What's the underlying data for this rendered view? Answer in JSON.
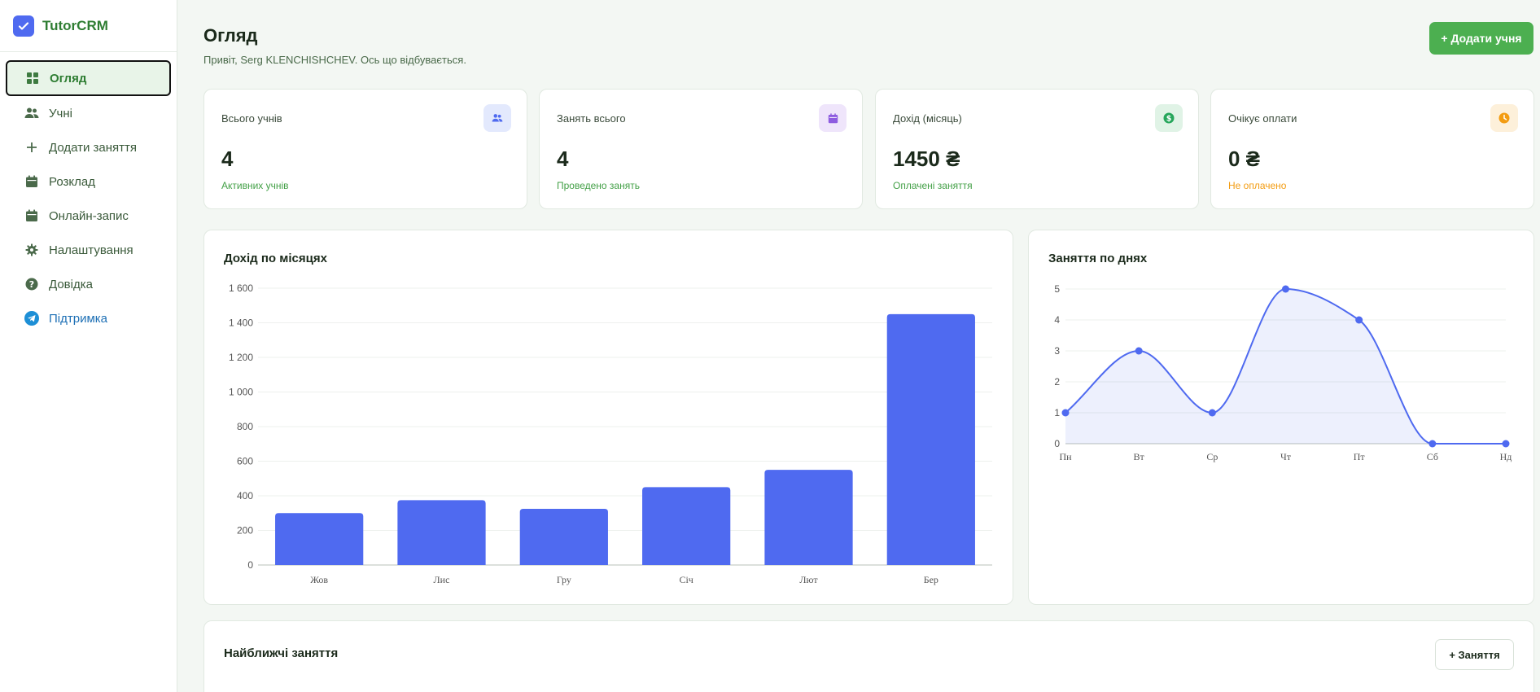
{
  "app": {
    "name": "TutorCRM"
  },
  "sidebar": {
    "items": [
      {
        "label": "Огляд",
        "icon": "grid-icon",
        "active": true
      },
      {
        "label": "Учні",
        "icon": "users-icon"
      },
      {
        "label": "Додати заняття",
        "icon": "plus-icon"
      },
      {
        "label": "Розклад",
        "icon": "calendar-icon"
      },
      {
        "label": "Онлайн-запис",
        "icon": "calendar-icon"
      },
      {
        "label": "Налаштування",
        "icon": "gear-icon"
      },
      {
        "label": "Довідка",
        "icon": "help-icon"
      },
      {
        "label": "Підтримка",
        "icon": "telegram-icon"
      }
    ]
  },
  "header": {
    "title": "Огляд",
    "greeting": "Привіт, Serg KLENCHISHCHEV. Ось що відбувається.",
    "add_student_label": "+ Додати учня"
  },
  "stats": [
    {
      "label": "Всього учнів",
      "value": "4",
      "sub": "Активних учнів",
      "icon": "users-icon",
      "color": "#4f6af0"
    },
    {
      "label": "Занять всього",
      "value": "4",
      "sub": "Проведено занять",
      "icon": "calendar-icon",
      "color": "#8e5ce0"
    },
    {
      "label": "Дохід (місяць)",
      "value": "1450 ₴",
      "sub": "Оплачені заняття",
      "icon": "dollar-icon",
      "color": "#26a65b"
    },
    {
      "label": "Очікує оплати",
      "value": "0 ₴",
      "sub": "Не оплачено",
      "icon": "clock-icon",
      "color": "#f39c12"
    }
  ],
  "revenue_card": {
    "title": "Дохід по місяцях"
  },
  "lessons_card": {
    "title": "Заняття по днях"
  },
  "upcoming": {
    "title": "Найближчі заняття",
    "add_label": "+ Заняття"
  },
  "chart_data": [
    {
      "type": "bar",
      "title": "Дохід по місяцях",
      "categories": [
        "Жов",
        "Лис",
        "Гру",
        "Січ",
        "Лют",
        "Бер"
      ],
      "values": [
        300,
        375,
        325,
        450,
        550,
        1450
      ],
      "yticks": [
        "0",
        "200",
        "400",
        "600",
        "800",
        "1 000",
        "1 200",
        "1 400",
        "1 600"
      ],
      "ylim": [
        0,
        1600
      ],
      "grid": true,
      "color": "#4f6af0"
    },
    {
      "type": "area",
      "title": "Заняття по днях",
      "categories": [
        "Пн",
        "Вт",
        "Ср",
        "Чт",
        "Пт",
        "Сб",
        "Нд"
      ],
      "values": [
        1,
        3,
        1,
        5,
        4,
        0,
        0
      ],
      "yticks": [
        "0",
        "1",
        "2",
        "3",
        "4",
        "5"
      ],
      "ylim": [
        0,
        5
      ],
      "grid": true,
      "color": "#4f6af0"
    }
  ]
}
